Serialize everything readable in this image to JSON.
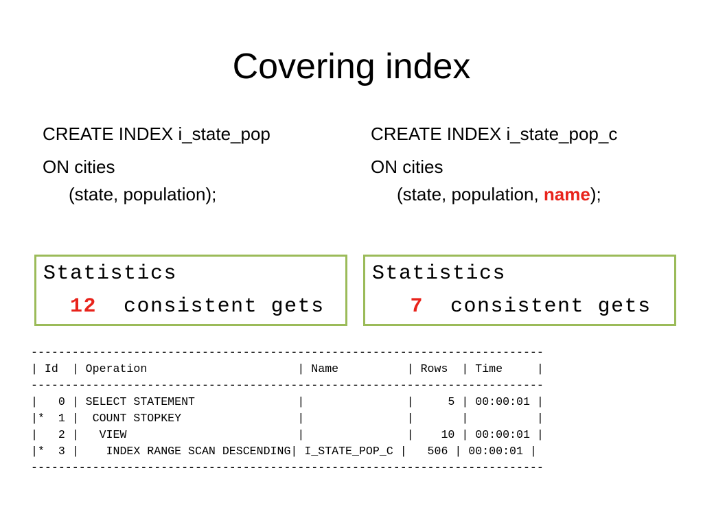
{
  "slide": {
    "title": "Covering index"
  },
  "left_index": {
    "line1": "CREATE INDEX i_state_pop",
    "line2": "ON cities",
    "line3": "(state, population);"
  },
  "right_index": {
    "line1": "CREATE INDEX i_state_pop_c",
    "line2": "ON cities",
    "line3_prefix": "(state, population, ",
    "line3_highlight": "name",
    "line3_suffix": ");"
  },
  "left_stats": {
    "heading": "Statistics",
    "value": "12",
    "label": "consistent gets"
  },
  "right_stats": {
    "heading": "Statistics",
    "value": "7",
    "label": "consistent gets"
  },
  "execution_plan": {
    "lines": [
      "---------------------------------------------------------------------------",
      "| Id  | Operation                      | Name          | Rows  | Time     |",
      "---------------------------------------------------------------------------",
      "|   0 | SELECT STATEMENT               |               |     5 | 00:00:01 |",
      "|*  1 |  COUNT STOPKEY                 |               |       |          |",
      "|   2 |   VIEW                         |               |    10 | 00:00:01 |",
      "|*  3 |    INDEX RANGE SCAN DESCENDING| I_STATE_POP_C |   506 | 00:00:01 |",
      "---------------------------------------------------------------------------"
    ]
  },
  "colors": {
    "highlight": "#e8231b",
    "box_border": "#9bbb59"
  }
}
